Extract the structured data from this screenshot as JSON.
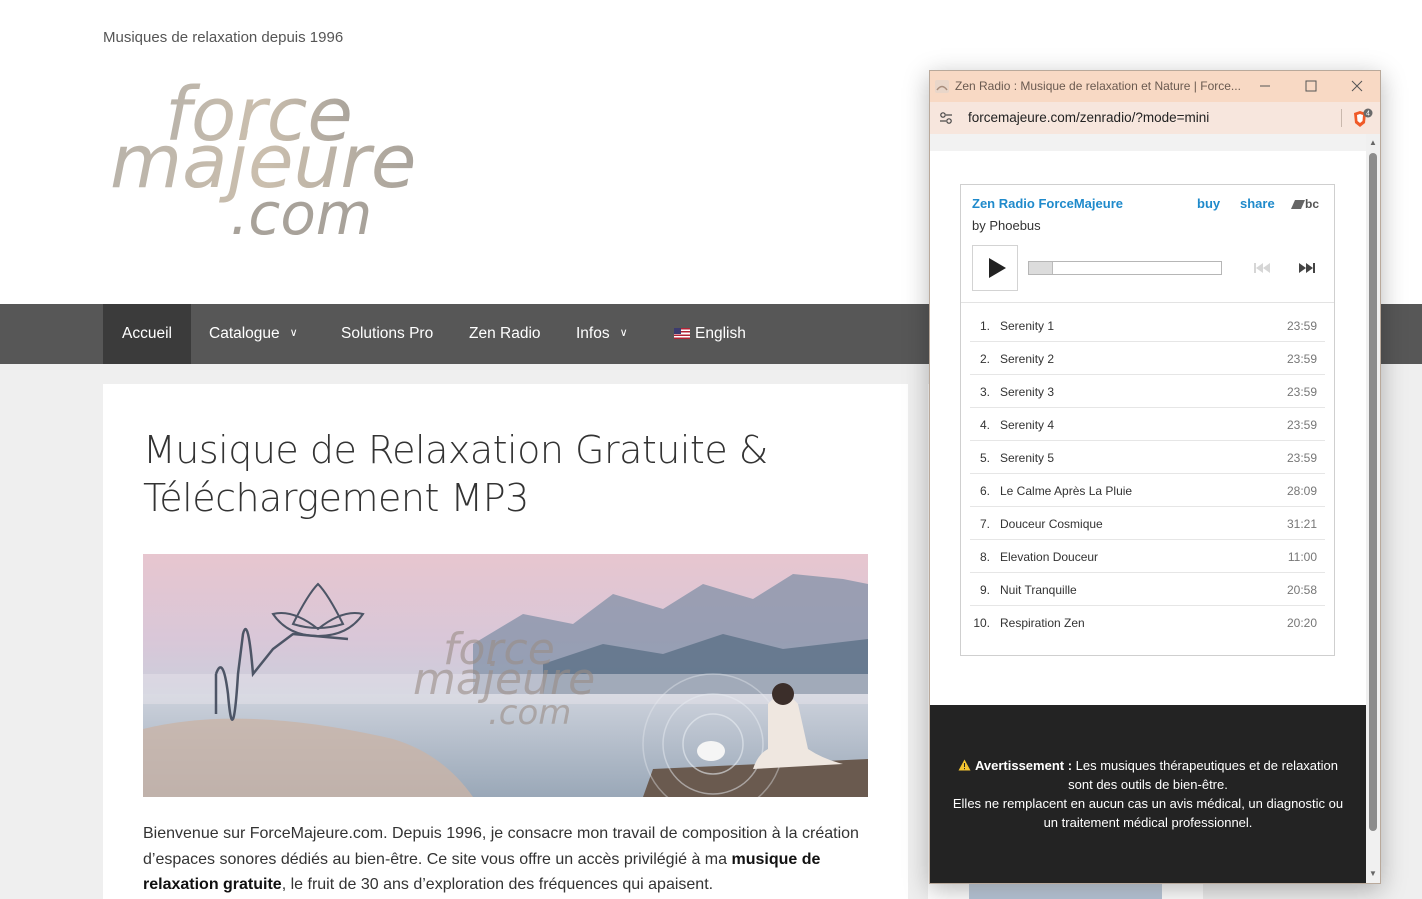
{
  "site": {
    "tagline": "Musiques de relaxation depuis 1996",
    "logo": {
      "line1": "force",
      "line2": "majeure",
      "line3": ".com"
    }
  },
  "nav": {
    "items": [
      {
        "label": "Accueil",
        "active": true
      },
      {
        "label": "Catalogue",
        "has_dropdown": true
      },
      {
        "label": "Solutions Pro"
      },
      {
        "label": "Zen Radio"
      },
      {
        "label": "Infos",
        "has_dropdown": true
      },
      {
        "label": "English",
        "icon": "us-flag-icon"
      }
    ]
  },
  "main": {
    "title": "Musique de Relaxation Gratuite & Téléchargement MP3",
    "hero_watermark": {
      "line1": "force",
      "line2": "majeure",
      "line3": ".com"
    },
    "intro_part1": "Bienvenue sur ForceMajeure.com. Depuis 1996, je consacre mon travail de composition à la création d’espaces sonores dédiés au bien-être. Ce site vous offre un accès privilégié à ma ",
    "intro_bold": "musique de relaxation gratuite",
    "intro_part2": ", le fruit de 30 ans d’exploration des fréquences qui apaisent."
  },
  "popup": {
    "window_title": "Zen Radio : Musique de relaxation et Nature | Force...",
    "url": "forcemajeure.com/zenradio/?mode=mini",
    "shield_badge": "4",
    "player": {
      "album_title": "Zen Radio ForceMajeure",
      "artist": "by Phoebus",
      "buy_label": "buy",
      "share_label": "share",
      "brand": "bc",
      "progress": 0.12,
      "tracks": [
        {
          "num": "1.",
          "title": "Serenity 1",
          "duration": "23:59"
        },
        {
          "num": "2.",
          "title": "Serenity 2",
          "duration": "23:59"
        },
        {
          "num": "3.",
          "title": "Serenity 3",
          "duration": "23:59"
        },
        {
          "num": "4.",
          "title": "Serenity 4",
          "duration": "23:59"
        },
        {
          "num": "5.",
          "title": "Serenity 5",
          "duration": "23:59"
        },
        {
          "num": "6.",
          "title": "Le Calme Après La Pluie",
          "duration": "28:09"
        },
        {
          "num": "7.",
          "title": "Douceur Cosmique",
          "duration": "31:21"
        },
        {
          "num": "8.",
          "title": "Elevation Douceur",
          "duration": "11:00"
        },
        {
          "num": "9.",
          "title": "Nuit Tranquille",
          "duration": "20:58"
        },
        {
          "num": "10.",
          "title": "Respiration Zen",
          "duration": "20:20"
        }
      ]
    },
    "warning": {
      "label": "Avertissement :",
      "text1": " Les musiques thérapeutiques et de relaxation sont des outils de bien-être.",
      "text2": "Elles ne remplacent en aucun cas un avis médical, un diagnostic ou un traitement médical professionnel."
    }
  },
  "colors": {
    "nav_bg": "#575757",
    "nav_active": "#3b3b3b",
    "bandcamp_link": "#1f8acb",
    "popup_titlebar": "#f8d9c4",
    "warning_bg": "#232323"
  }
}
